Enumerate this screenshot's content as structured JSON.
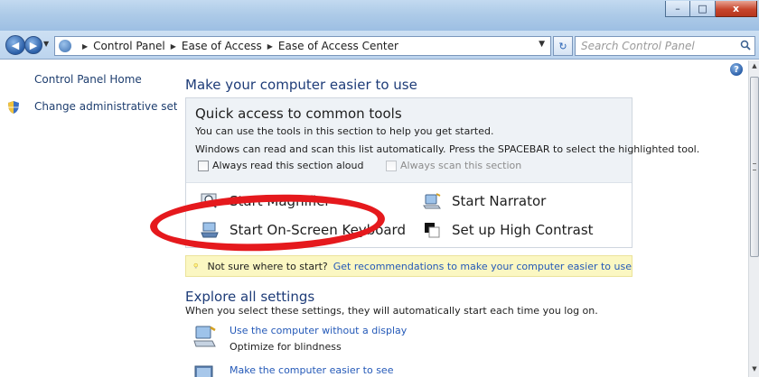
{
  "window": {
    "minimize_glyph": "–",
    "maximize_glyph": "□",
    "close_glyph": "x"
  },
  "nav": {
    "back_glyph": "◀",
    "forward_glyph": "▶",
    "breadcrumbs": [
      "Control Panel",
      "Ease of Access",
      "Ease of Access Center"
    ],
    "crumb_separator": "▶",
    "refresh_glyph": "↻",
    "search_placeholder": "Search Control Panel"
  },
  "left_pane": {
    "home_link": "Control Panel Home",
    "admin_link": "Change administrative settings"
  },
  "main": {
    "help_glyph": "?",
    "page_title": "Make your computer easier to use",
    "quick_access": {
      "title": "Quick access to common tools",
      "line1": "You can use the tools in this section to help you get started.",
      "line2": "Windows can read and scan this list automatically.  Press the SPACEBAR to select the highlighted tool.",
      "read_aloud_label": "Always read this section aloud",
      "read_aloud_checked": false,
      "scan_label": "Always scan this section",
      "scan_checked": false,
      "scan_enabled": false
    },
    "tools": {
      "magnifier": "Start Magnifier",
      "narrator": "Start Narrator",
      "on_screen_keyboard": "Start On-Screen Keyboard",
      "high_contrast": "Set up High Contrast"
    },
    "tip": {
      "text": "Not sure where to start?",
      "link": "Get recommendations to make your computer easier to use"
    },
    "explore": {
      "title": "Explore all settings",
      "subtitle": "When you select these settings, they will automatically start each time you log on.",
      "settings": [
        {
          "link": "Use the computer without a display",
          "desc": "Optimize for blindness"
        },
        {
          "link": "Make the computer easier to see",
          "desc": ""
        }
      ]
    }
  },
  "colors": {
    "link": "#2459b8",
    "title": "#1e3c78",
    "annotation_oval": "#e5191d",
    "tip_background": "#fbf7c2"
  },
  "icons": {
    "help": "help-icon",
    "shield": "shield-icon",
    "bulb": "lightbulb-icon",
    "magnifier": "magnifier-icon",
    "narrator": "narrator-icon",
    "keyboard": "keyboard-icon",
    "contrast": "contrast-icon",
    "search": "search-icon"
  }
}
